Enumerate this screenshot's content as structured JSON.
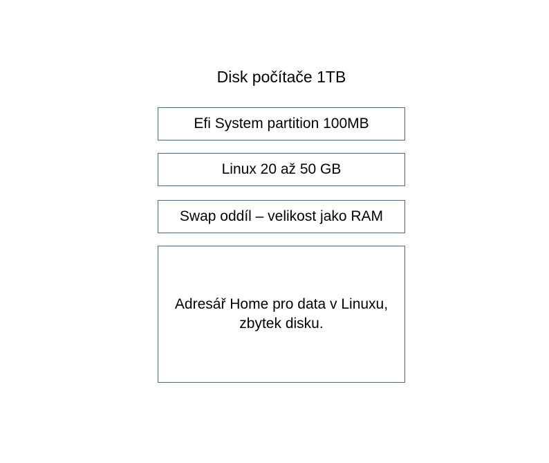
{
  "diagram": {
    "title": "Disk počítače 1TB",
    "partitions": [
      {
        "label": "Efi System partition 100MB"
      },
      {
        "label": "Linux 20 až 50 GB"
      },
      {
        "label": "Swap oddíl – velikost jako RAM"
      },
      {
        "label": "Adresář Home pro data v Linuxu, zbytek disku."
      }
    ]
  }
}
